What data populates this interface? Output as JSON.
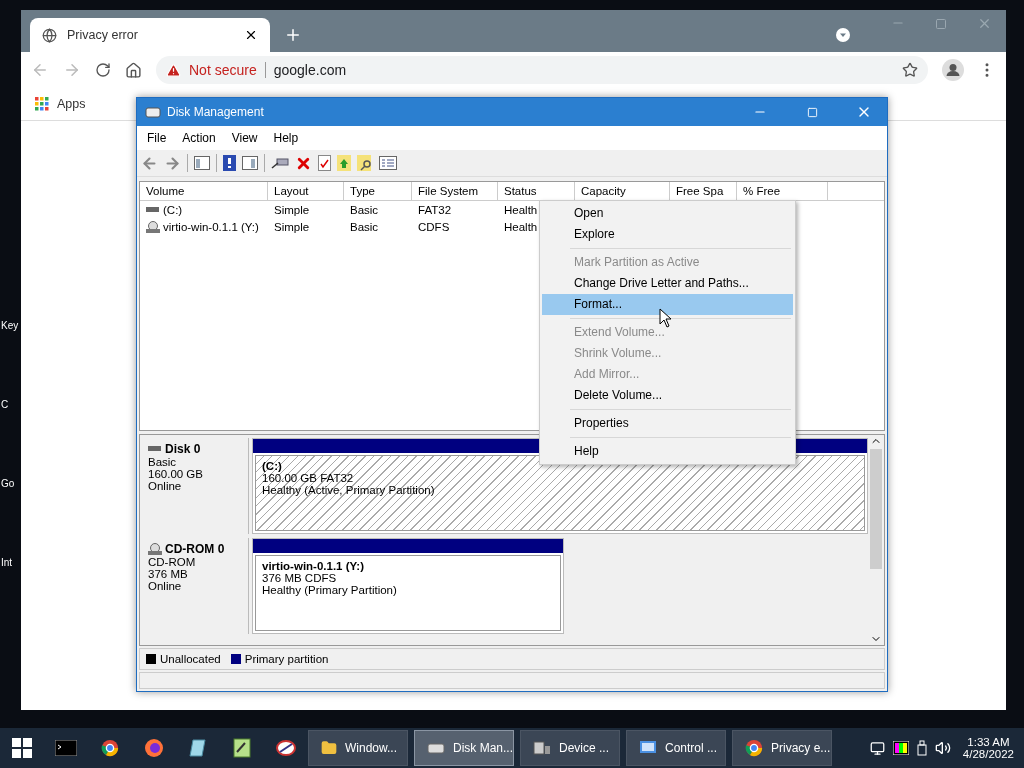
{
  "desktop": {
    "labels": [
      "Key",
      "C",
      "Go",
      "Int"
    ]
  },
  "browser": {
    "tab": {
      "title": "Privacy error"
    },
    "address": {
      "security": "Not secure",
      "url": "google.com"
    },
    "bookmarks": [
      "Apps"
    ]
  },
  "disk_management": {
    "title": "Disk Management",
    "menu": [
      "File",
      "Action",
      "View",
      "Help"
    ],
    "columns": [
      "Volume",
      "Layout",
      "Type",
      "File System",
      "Status",
      "Capacity",
      "Free Spa",
      "% Free"
    ],
    "rows": [
      {
        "kind": "disk",
        "cells": [
          "(C:)",
          "Simple",
          "Basic",
          "FAT32",
          "Health"
        ]
      },
      {
        "kind": "cd",
        "cells": [
          "virtio-win-0.1.1 (Y:)",
          "Simple",
          "Basic",
          "CDFS",
          "Health"
        ]
      }
    ],
    "disks": [
      {
        "kind": "disk",
        "name": "Disk 0",
        "lines": [
          "Basic",
          "160.00 GB",
          "Online"
        ],
        "partition": {
          "name": "(C:)",
          "size": "160.00 GB FAT32",
          "status": "Healthy (Active, Primary Partition)",
          "selected": true
        }
      },
      {
        "kind": "cd",
        "name": "CD-ROM 0",
        "lines": [
          "CD-ROM",
          "376 MB",
          "Online"
        ],
        "partition": {
          "name": "virtio-win-0.1.1  (Y:)",
          "size": "376 MB CDFS",
          "status": "Healthy (Primary Partition)",
          "selected": false
        }
      }
    ],
    "legend": [
      {
        "label": "Unallocated",
        "color": "#000000"
      },
      {
        "label": "Primary partition",
        "color": "#000080"
      }
    ]
  },
  "context_menu": {
    "items": [
      {
        "kind": "item",
        "label": "Open",
        "disabled": false,
        "selected": false
      },
      {
        "kind": "item",
        "label": "Explore",
        "disabled": false,
        "selected": false
      },
      {
        "kind": "separator"
      },
      {
        "kind": "item",
        "label": "Mark Partition as Active",
        "disabled": true,
        "selected": false
      },
      {
        "kind": "item",
        "label": "Change Drive Letter and Paths...",
        "disabled": false,
        "selected": false
      },
      {
        "kind": "item",
        "label": "Format...",
        "disabled": false,
        "selected": true
      },
      {
        "kind": "separator"
      },
      {
        "kind": "item",
        "label": "Extend Volume...",
        "disabled": true,
        "selected": false
      },
      {
        "kind": "item",
        "label": "Shrink Volume...",
        "disabled": true,
        "selected": false
      },
      {
        "kind": "item",
        "label": "Add Mirror...",
        "disabled": true,
        "selected": false
      },
      {
        "kind": "item",
        "label": "Delete Volume...",
        "disabled": false,
        "selected": false
      },
      {
        "kind": "separator"
      },
      {
        "kind": "item",
        "label": "Properties",
        "disabled": false,
        "selected": false
      },
      {
        "kind": "separator"
      },
      {
        "kind": "item",
        "label": "Help",
        "disabled": false,
        "selected": false
      }
    ]
  },
  "taskbar": {
    "tasks": [
      {
        "kind": "folder",
        "label": "Window...",
        "selected": false
      },
      {
        "kind": "disk",
        "label": "Disk Man...",
        "selected": true
      },
      {
        "kind": "device",
        "label": "Device ...",
        "selected": false
      },
      {
        "kind": "control",
        "label": "Control ...",
        "selected": false
      },
      {
        "kind": "chrome",
        "label": "Privacy e...",
        "selected": false
      }
    ],
    "clock": {
      "time": "1:33 AM",
      "date": "4/28/2022"
    }
  }
}
